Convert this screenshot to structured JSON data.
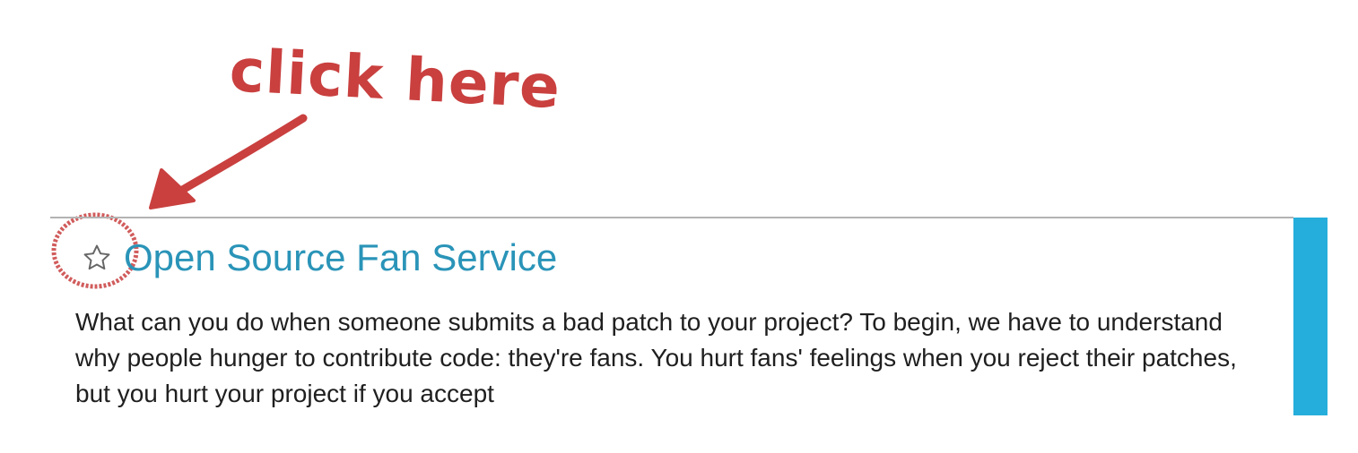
{
  "annotation": {
    "text": "click here",
    "color": "#c9403f"
  },
  "article": {
    "title": "Open Source Fan Service",
    "title_color": "#2a94b8",
    "star_icon": "star-outline-icon",
    "body": "What can you do when someone submits a bad patch to your project? To begin, we have to understand why people hunger to contribute code: they're fans. You hurt fans' feelings when you reject their patches, but you hurt your project if you accept"
  },
  "sidebar": {
    "color": "#25aedb"
  }
}
